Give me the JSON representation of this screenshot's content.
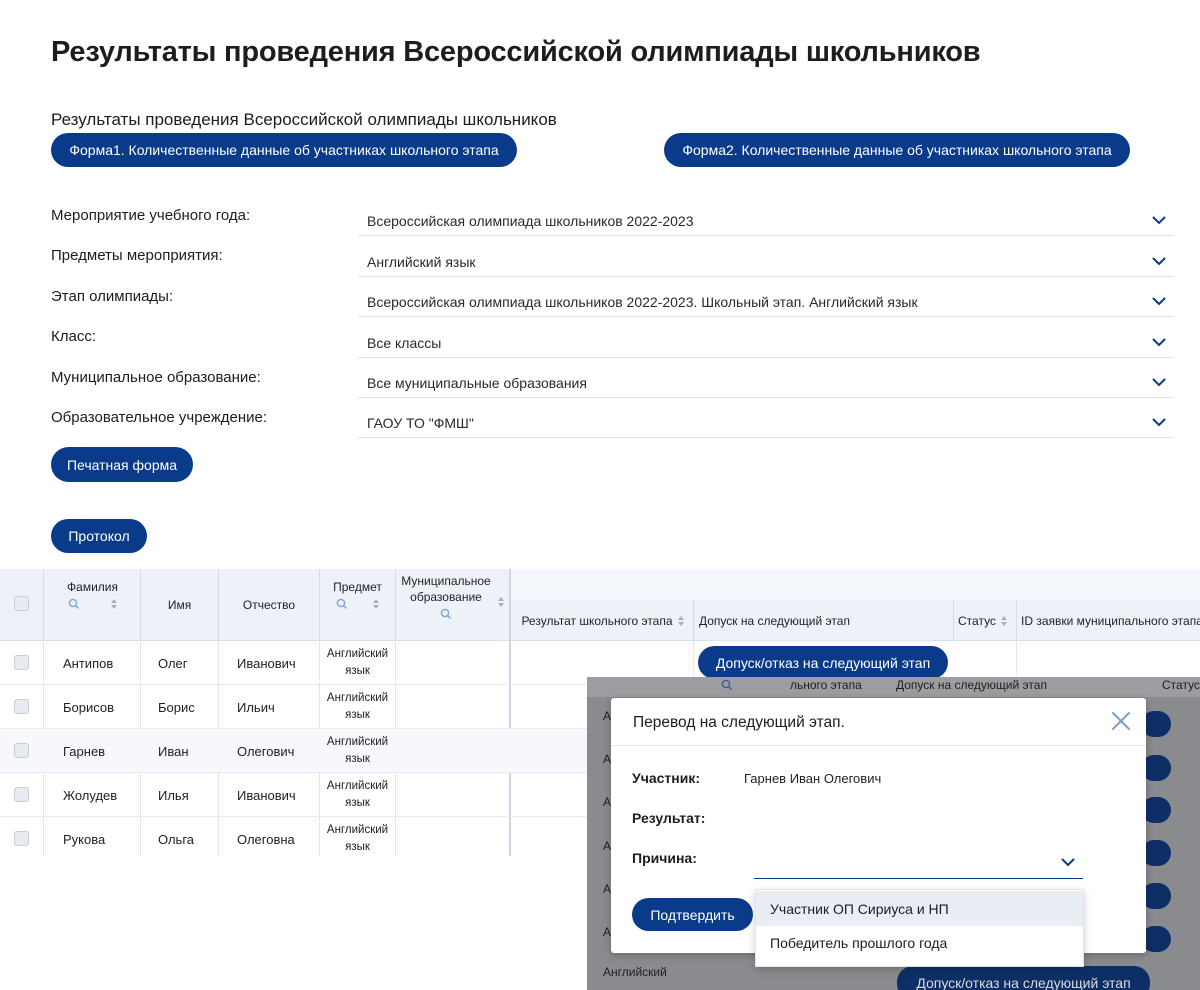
{
  "page": {
    "title": "Результаты проведения Всероссийской олимпиады школьников",
    "section_title": "Результаты проведения Всероссийской олимпиады школьников"
  },
  "buttons": {
    "form1": "Форма1. Количественные данные об участниках школьного этапа",
    "form2": "Форма2. Количественные данные об участниках школьного этапа",
    "print": "Печатная форма",
    "protocol": "Протокол",
    "dopusk": "Допуск/отказ на следующий этап",
    "dopusk_bottom": "Допуск/отказ на следующий этап",
    "confirm": "Подтвердить"
  },
  "filters": [
    {
      "label": "Мероприятие учебного года:",
      "value": "Всероссийская олимпиада школьников 2022-2023"
    },
    {
      "label": "Предметы мероприятия:",
      "value": "Английский язык"
    },
    {
      "label": "Этап олимпиады:",
      "value": "Всероссийская олимпиада школьников 2022-2023. Школьный этап. Английский язык"
    },
    {
      "label": "Класс:",
      "value": "Все классы"
    },
    {
      "label": "Муниципальное образование:",
      "value": "Все муниципальные образования"
    },
    {
      "label": "Образовательное учреждение:",
      "value": "ГАОУ ТО \"ФМШ\""
    }
  ],
  "table": {
    "headers": {
      "surname": "Фамилия",
      "name": "Имя",
      "patronymic": "Отчество",
      "subject": "Предмет",
      "municipal": "Муниципальное образование",
      "result": "Результат школьного этапа",
      "admission": "Допуск на следующий этап",
      "status": "Статус",
      "request_id": "ID заявки муниципального этапа"
    },
    "rows": [
      {
        "surname": "Антипов",
        "name": "Олег",
        "patronymic": "Иванович",
        "subject": "Английский язык"
      },
      {
        "surname": "Борисов",
        "name": "Борис",
        "patronymic": "Ильич",
        "subject": "Английский язык"
      },
      {
        "surname": "Гарнев",
        "name": "Иван",
        "patronymic": "Олегович",
        "subject": "Английский язык"
      },
      {
        "surname": "Жолудев",
        "name": "Илья",
        "patronymic": "Иванович",
        "subject": "Английский язык"
      },
      {
        "surname": "Рукова",
        "name": "Ольга",
        "patronymic": "Олеговна",
        "subject": "Английский язык"
      }
    ]
  },
  "overlay": {
    "header_result": "льного этапа",
    "header_admission": "Допуск на следующий этап",
    "header_status": "Статус",
    "row_labels": [
      "А",
      "А",
      "А",
      "А",
      "А",
      "А"
    ],
    "bottom_subject": "Английский"
  },
  "modal": {
    "title": "Перевод на следующий этап.",
    "participant_label": "Участник:",
    "participant_value": "Гарнев Иван Олегович",
    "result_label": "Результат:",
    "reason_label": "Причина:",
    "reason_options": [
      "Участник ОП Сириуса и НП",
      "Победитель прошлого года"
    ]
  },
  "colors": {
    "primary": "#0a3b8a",
    "header_bg": "#eef2f8"
  }
}
